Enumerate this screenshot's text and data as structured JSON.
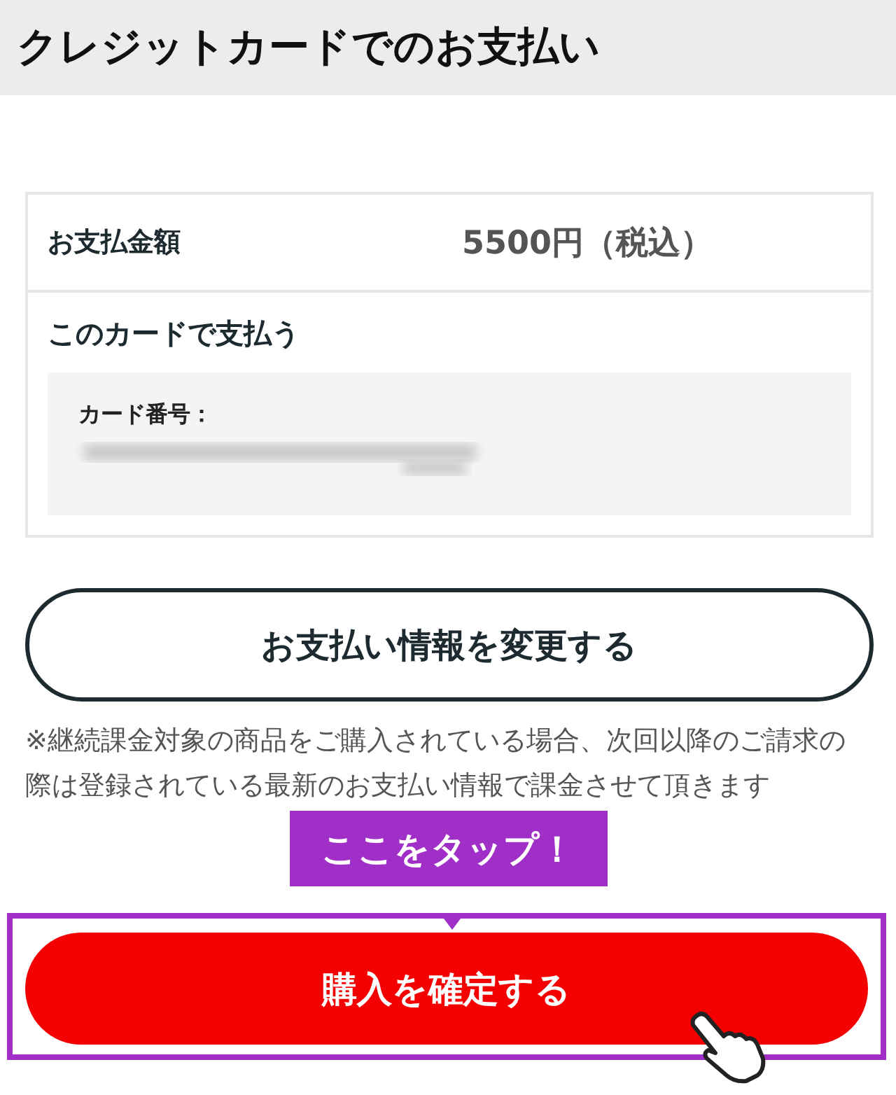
{
  "header": {
    "title": "クレジットカードでのお支払い"
  },
  "summary": {
    "amount_label": "お支払金額",
    "amount": "5500円（税込）",
    "card_heading": "このカードで支払う",
    "card_number_label": "カード番号："
  },
  "change_button": "お支払い情報を変更する",
  "note": "※継続課金対象の商品をご購入されている場合、次回以降のご請求の際は登録されている最新のお支払い情報で課金させて頂きます",
  "callout": "ここをタップ！",
  "confirm_button": "購入を確定する"
}
